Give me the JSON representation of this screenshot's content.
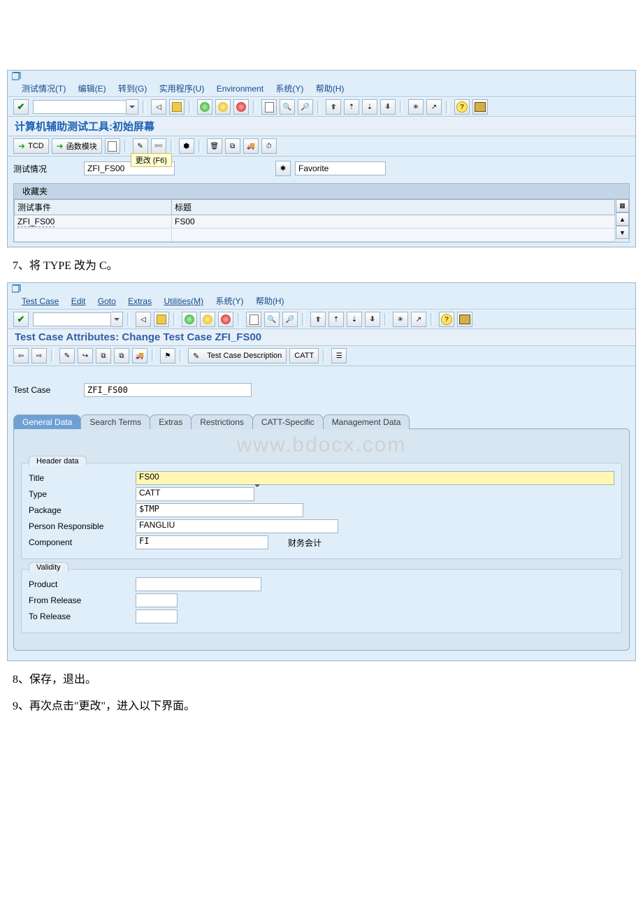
{
  "doc": {
    "step7": "7、将 TYPE 改为 C。",
    "step8": "8、保存，退出。",
    "step9": "9、再次点击\"更改\"，进入以下界面。",
    "watermark": "www.bdocx.com"
  },
  "shot1": {
    "menu": {
      "test_case": "测试情况(T)",
      "edit": "编辑(E)",
      "goto": "转到(G)",
      "utilities": "实用程序(U)",
      "environment": "Environment",
      "system": "系统(Y)",
      "help": "帮助(H)"
    },
    "title": "计算机辅助测试工具:初始屏幕",
    "toolbar": {
      "tcd": "TCD",
      "func": "函数模块",
      "tooltip": "更改  (F6)"
    },
    "testcase_label": "测试情况",
    "testcase_value": "ZFI_FS00",
    "favorite_label": "Favorite",
    "favorites_header": "收藏夹",
    "col_event": "测试事件",
    "col_title": "标题",
    "row_event": "ZFI_FS00",
    "row_title": "FS00"
  },
  "shot2": {
    "menu": {
      "test_case": "Test Case",
      "edit": "Edit",
      "goto": "Goto",
      "extras": "Extras",
      "utilities": "Utilities(M)",
      "system": "系统(Y)",
      "help": "帮助(H)"
    },
    "title": "Test Case Attributes: Change Test Case ZFI_FS00",
    "toolbar": {
      "desc_btn": "Test Case Description",
      "catt_btn": "CATT"
    },
    "testcase_label": "Test Case",
    "testcase_value": "ZFI_FS00",
    "tabs": {
      "general": "General Data",
      "search": "Search Terms",
      "extras": "Extras",
      "restrictions": "Restrictions",
      "catt": "CATT-Specific",
      "mgmt": "Management Data"
    },
    "header_group": "Header data",
    "fields": {
      "title_lbl": "Title",
      "title_val": "FS00",
      "type_lbl": "Type",
      "type_val": "CATT",
      "package_lbl": "Package",
      "package_val": "$TMP",
      "person_lbl": "Person Responsible",
      "person_val": "FANGLIU",
      "component_lbl": "Component",
      "component_val": "FI",
      "component_txt": "财务会计"
    },
    "validity_group": "Validity",
    "validity": {
      "product_lbl": "Product",
      "from_lbl": "From Release",
      "to_lbl": "To Release"
    }
  }
}
